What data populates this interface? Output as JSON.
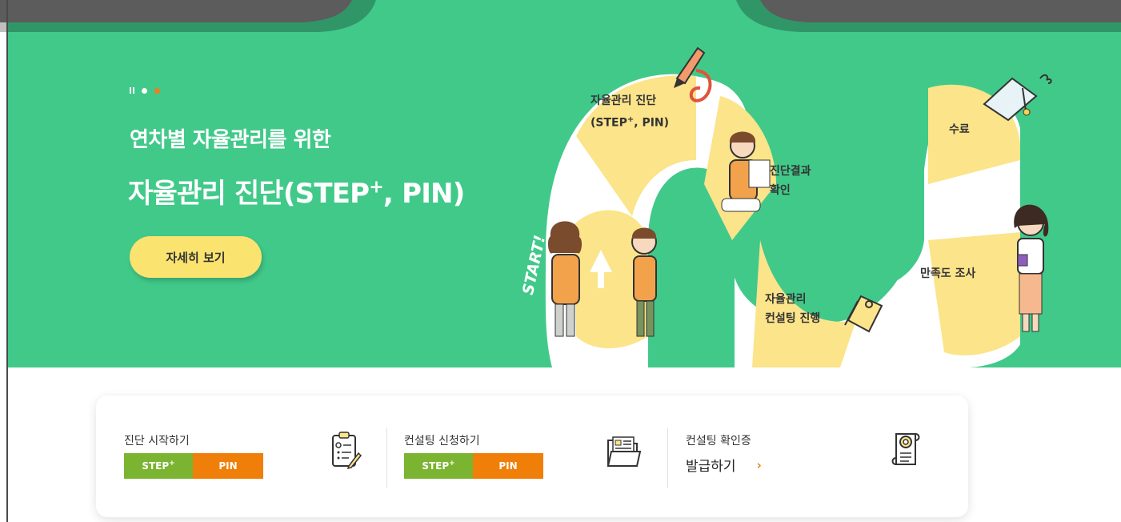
{
  "hero": {
    "pager": {
      "pause": "pause-icon",
      "colors": {
        "active": "#f07c1c",
        "inactive": "#ffffff"
      }
    },
    "headline_small": "연차별 자율관리를 위한",
    "headline_large_prefix": "자율관리 진단(STEP",
    "headline_large_sup": "+",
    "headline_large_suffix": ", PIN)",
    "cta_label": "자세히 보기",
    "background_color": "#41c98a",
    "steps": {
      "step1_line1": "자율관리 진단",
      "step1_line2_prefix": "(STEP",
      "step1_line2_sup": "+",
      "step1_line2_suffix": ", PIN)",
      "step2_line1": "진단결과",
      "step2_line2": "확인",
      "step3_line1": "자율관리",
      "step3_line2": "컨설팅 진행",
      "step4": "만족도 조사",
      "step5": "수료",
      "start": "START!"
    }
  },
  "quick_menu": {
    "diagnosis": {
      "title": "진단 시작하기",
      "step_label": "STEP",
      "step_sup": "+",
      "pin_label": "PIN",
      "icon": "checklist-clipboard-icon"
    },
    "consulting": {
      "title": "컨설팅 신청하기",
      "step_label": "STEP",
      "step_sup": "+",
      "pin_label": "PIN",
      "icon": "folder-document-icon"
    },
    "certificate": {
      "title": "컨설팅 확인증",
      "link_label": "발급하기",
      "chevron": "›",
      "icon": "certificate-scroll-icon"
    },
    "colors": {
      "step": "#7bb431",
      "pin": "#ef7f08"
    }
  }
}
